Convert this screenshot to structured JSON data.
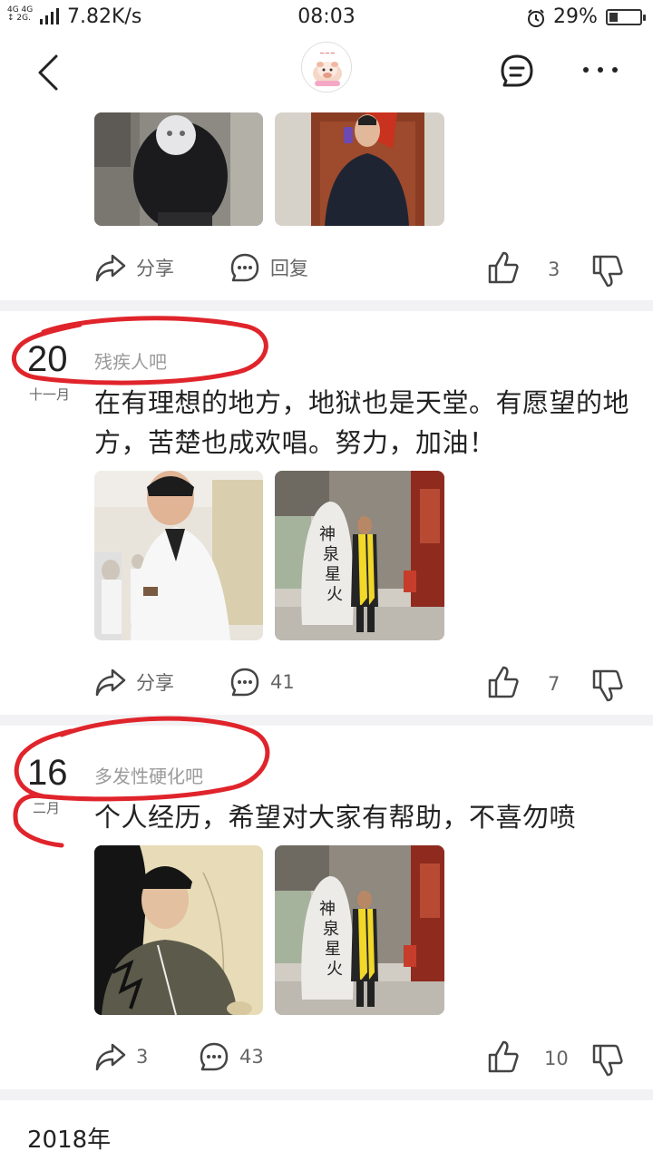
{
  "status_bar": {
    "network": "4G 4G 2G",
    "speed": "7.82K/s",
    "time": "08:03",
    "battery_text": "29%",
    "battery_level": 0.29
  },
  "header": {
    "back_icon": "chevron-left-icon",
    "message_icon": "message-icon",
    "more_icon": "more-dots-icon"
  },
  "posts": [
    {
      "actions": {
        "share": "分享",
        "reply": "回复",
        "likes": "3"
      }
    },
    {
      "day": "20",
      "month": "十一月",
      "forum": "残疾人吧",
      "text": "在有理想的地方，地狱也是天堂。有愿望的地方，苦楚也成欢唱。努力，加油！",
      "actions": {
        "share": "分享",
        "comments": "41",
        "likes": "7"
      }
    },
    {
      "day": "16",
      "month": "二月",
      "forum": "多发性硬化吧",
      "text": "个人经历，希望对大家有帮助，不喜勿喷",
      "actions": {
        "shares": "3",
        "comments": "43",
        "likes": "10"
      }
    }
  ],
  "year_label": "2018年",
  "colors": {
    "annotation_red": "#e0242b",
    "divider": "#f2f2f4",
    "muted": "#9a9a9a"
  }
}
